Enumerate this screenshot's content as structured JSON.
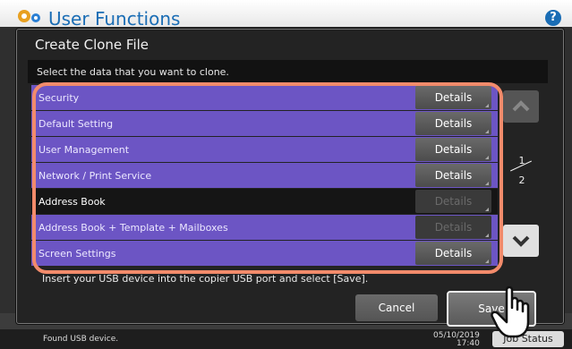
{
  "app": {
    "title": "User Functions",
    "help_label": "?",
    "gear_icon": "gear-icon"
  },
  "dialog": {
    "title": "Create Clone File",
    "instruction": "Select the data that you want to clone.",
    "usb_message": "Insert your USB device into the copier USB port and select [Save].",
    "cancel_label": "Cancel",
    "save_label": "Save"
  },
  "rows": [
    {
      "label": "Security",
      "details": "Details",
      "enabled": true
    },
    {
      "label": "Default Setting",
      "details": "Details",
      "enabled": true
    },
    {
      "label": "User Management",
      "details": "Details",
      "enabled": true
    },
    {
      "label": "Network / Print Service",
      "details": "Details",
      "enabled": true
    },
    {
      "label": "Address Book",
      "details": "Details",
      "enabled": false
    },
    {
      "label": "Address Book + Template + Mailboxes",
      "details": "Details",
      "enabled": false
    },
    {
      "label": "Screen Settings",
      "details": "Details",
      "enabled": true
    }
  ],
  "pager": {
    "current": "1",
    "total": "2",
    "up_icon": "chevron-up-icon",
    "down_icon": "chevron-down-icon"
  },
  "footer": {
    "status": "Found USB device.",
    "date": "05/10/2019",
    "time": "17:40",
    "jobs_label": "Job Status"
  },
  "colors": {
    "purple_row": "#6c55c4",
    "selected_row": "#151515",
    "highlight": "#f28b6b",
    "title_blue": "#1a6db5"
  }
}
